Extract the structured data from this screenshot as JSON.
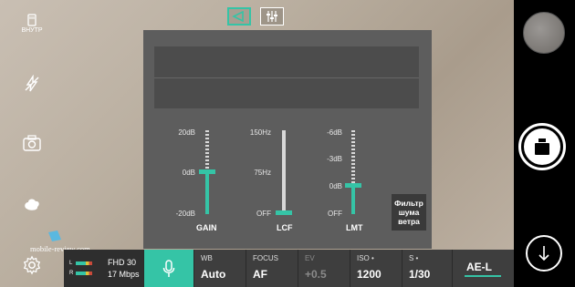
{
  "left_toolbar": {
    "storage_label": "ВНУТР",
    "icons": [
      "storage-icon",
      "flash-off-icon",
      "camera-switch-icon",
      "blob-shape-icon",
      "settings-icon"
    ]
  },
  "top_toggles": [
    {
      "icon": "audio-mixer-icon",
      "active": true
    },
    {
      "icon": "audio-levels-icon",
      "active": false
    }
  ],
  "audio_panel": {
    "sliders": [
      {
        "name": "GAIN",
        "ticks": [
          "20dB",
          "0dB",
          "-20dB"
        ],
        "value_label": "0dB"
      },
      {
        "name": "LCF",
        "ticks": [
          "150Hz",
          "75Hz",
          "OFF"
        ],
        "value_label": "OFF"
      },
      {
        "name": "LMT",
        "ticks": [
          "-6dB",
          "-3dB",
          "0dB",
          "OFF"
        ],
        "value_label": "0dB"
      }
    ],
    "noise_filter_label": "Фильтр шума ветра"
  },
  "watermark": "mobile-review.com",
  "bottom_bar": {
    "video": {
      "levels": [
        "L",
        "R"
      ],
      "resolution": "FHD 30",
      "bitrate": "17 Mbps"
    },
    "mic": {
      "icon": "microphone-icon",
      "active": true
    },
    "cells": [
      {
        "label": "WB",
        "value": "Auto",
        "dim": false
      },
      {
        "label": "FOCUS",
        "value": "AF",
        "dim": false
      },
      {
        "label": "EV",
        "value": "+0.5",
        "dim": true
      },
      {
        "label": "ISO •",
        "value": "1200",
        "dim": false
      },
      {
        "label": "S •",
        "value": "1/30",
        "dim": false
      }
    ],
    "ae_lock": "AE-L"
  },
  "colors": {
    "accent": "#35c4a6",
    "panel": "#5d5d5d",
    "bar": "#3e3e3e"
  }
}
